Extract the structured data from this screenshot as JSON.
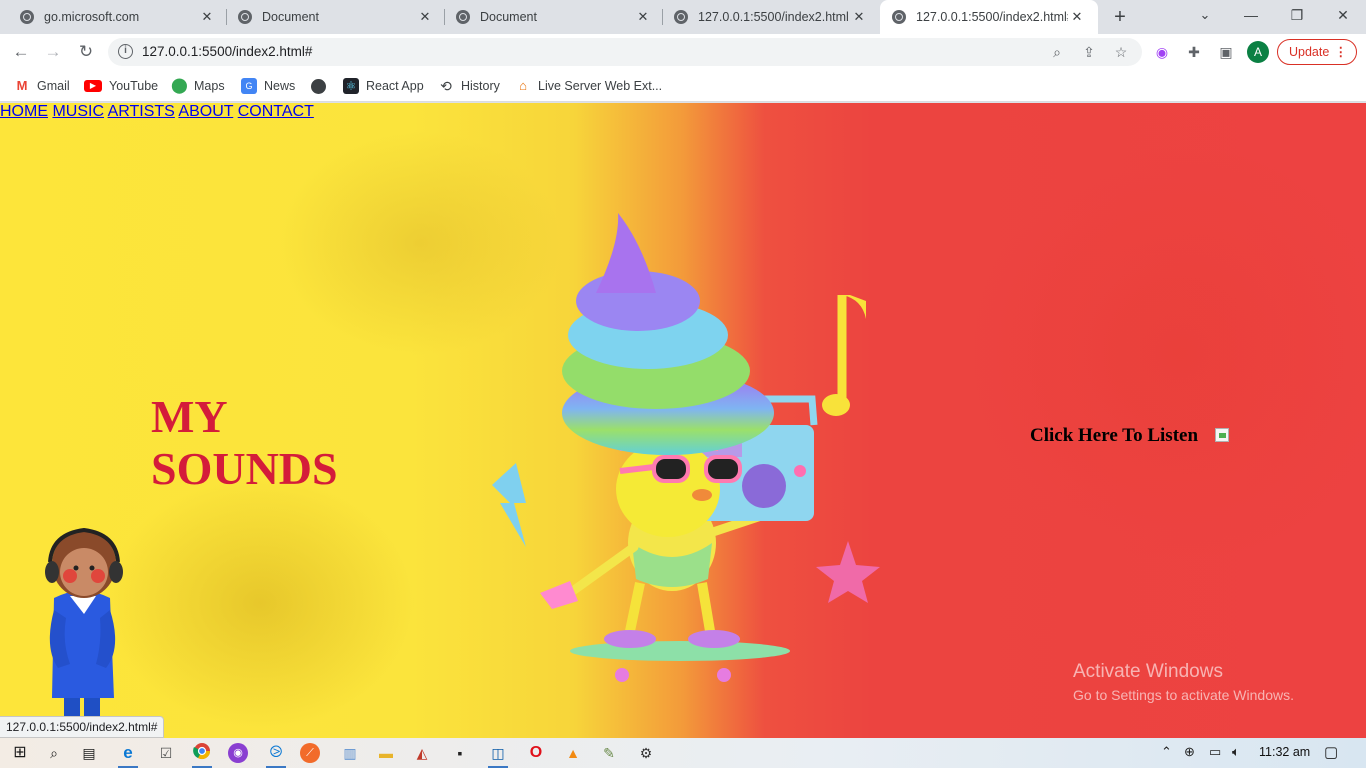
{
  "browser": {
    "tabs": [
      {
        "title": "go.microsoft.com"
      },
      {
        "title": "Document"
      },
      {
        "title": "Document"
      },
      {
        "title": "127.0.0.1:5500/index2.html"
      },
      {
        "title": "127.0.0.1:5500/index2.html#"
      }
    ],
    "new_tab": "+",
    "minimize": "—",
    "restore": "❐",
    "close": "✕",
    "address": "127.0.0.1:5500/index2.html#",
    "profile_initial": "A",
    "update_label": "Update",
    "bookmarks": [
      {
        "label": "Gmail"
      },
      {
        "label": "YouTube"
      },
      {
        "label": "Maps"
      },
      {
        "label": "News"
      },
      {
        "label": ""
      },
      {
        "label": "React App"
      },
      {
        "label": "History"
      },
      {
        "label": "Live Server Web Ext..."
      }
    ]
  },
  "page": {
    "nav": [
      "HOME",
      "MUSIC",
      "ARTISTS",
      "ABOUT",
      "CONTACT"
    ],
    "hero_title": "MY SOUNDS",
    "listen_label": "Click Here To Listen",
    "activate_title": "Activate Windows",
    "activate_subtitle": "Go to Settings to activate Windows.",
    "status_url": "127.0.0.1:5500/index2.html#"
  },
  "taskbar": {
    "clock": "11:32 am"
  },
  "colors": {
    "hero_title": "#d41c3a",
    "page_yellow": "#fde53a",
    "page_red": "#ed4241",
    "update_red": "#d93025"
  }
}
